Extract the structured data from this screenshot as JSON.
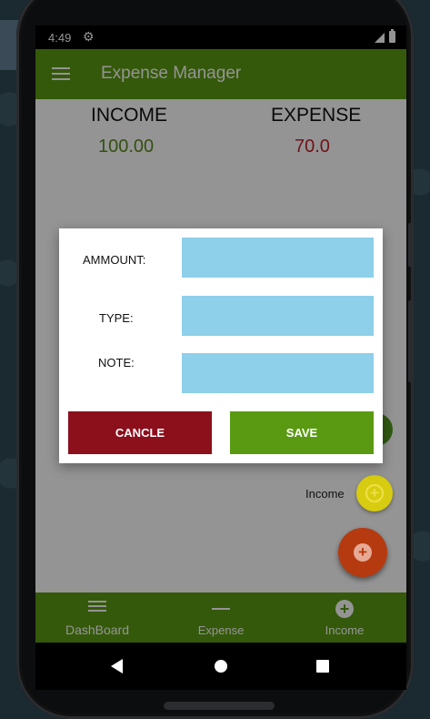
{
  "status_bar": {
    "time": "4:49",
    "settings_icon": "gear-icon",
    "signal_icon": "signal-icon",
    "battery_icon": "battery-icon"
  },
  "app_bar": {
    "title": "Expense Manager",
    "menu_icon": "hamburger-menu-icon"
  },
  "summary": {
    "income_label": "INCOME",
    "income_value": "100.00",
    "expense_label": "EXPENSE",
    "expense_value": "70.0",
    "income_color": "#5a8a20",
    "expense_color": "#c0222a"
  },
  "dialog": {
    "amount_label": "AMMOUNT:",
    "type_label": "TYPE:",
    "note_label": "NOTE:",
    "amount_value": "",
    "type_value": "",
    "note_value": "",
    "cancel_label": "CANCLE",
    "save_label": "SAVE"
  },
  "fab": {
    "income_label": "Income"
  },
  "bottom_nav": {
    "items": [
      {
        "label": "DashBoard",
        "icon": "menu-lines-icon"
      },
      {
        "label": "Expense",
        "icon": "minus-icon"
      },
      {
        "label": "Income",
        "icon": "plus-circle-icon"
      }
    ]
  },
  "colors": {
    "primary": "#5a9a12",
    "cancel": "#8c0f1c",
    "input": "#8ecfea",
    "fab_main": "#b53a10",
    "fab_income": "#d8cc10"
  }
}
